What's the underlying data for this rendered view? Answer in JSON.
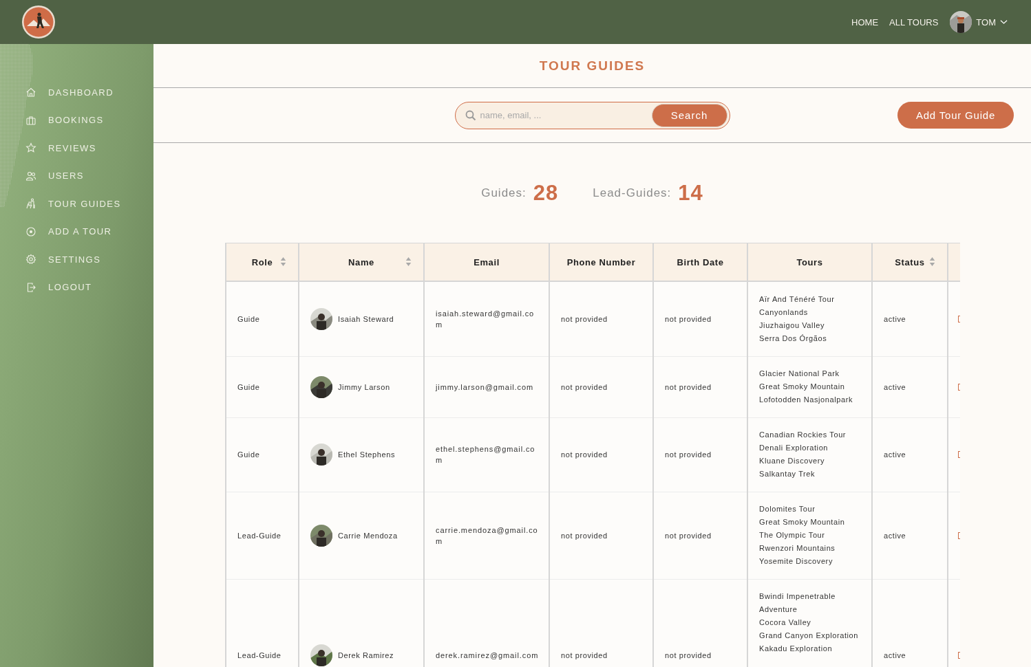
{
  "header": {
    "nav": [
      "HOME",
      "ALL TOURS"
    ],
    "user": {
      "name": "TOM"
    }
  },
  "sidebar": {
    "items": [
      {
        "label": "DASHBOARD"
      },
      {
        "label": "BOOKINGS"
      },
      {
        "label": "REVIEWS"
      },
      {
        "label": "USERS"
      },
      {
        "label": "TOUR GUIDES"
      },
      {
        "label": "ADD A TOUR"
      },
      {
        "label": "SETTINGS"
      },
      {
        "label": "LOGOUT"
      }
    ]
  },
  "page": {
    "title": "TOUR GUIDES"
  },
  "search": {
    "placeholder": "name, email, ...",
    "button": "Search"
  },
  "add_button": "Add Tour Guide",
  "stats": [
    {
      "label": "Guides:",
      "value": "28"
    },
    {
      "label": "Lead-Guides:",
      "value": "14"
    }
  ],
  "table": {
    "columns": [
      {
        "label": "Role",
        "sortable": true
      },
      {
        "label": "Name",
        "sortable": true
      },
      {
        "label": "Email",
        "sortable": false
      },
      {
        "label": "Phone Number",
        "sortable": false
      },
      {
        "label": "Birth Date",
        "sortable": false
      },
      {
        "label": "Tours",
        "sortable": false
      },
      {
        "label": "Status",
        "sortable": true
      }
    ],
    "rows": [
      {
        "role": "Guide",
        "name": "Isaiah Steward",
        "email": "isaiah.steward@gmail.com",
        "phone": "not provided",
        "birth_date": "not provided",
        "tours": [
          "Aïr And Ténéré Tour",
          "Canyonlands",
          "Jiuzhaigou Valley",
          "Serra Dos Órgãos"
        ],
        "status": "active"
      },
      {
        "role": "Guide",
        "name": "Jimmy Larson",
        "email": "jimmy.larson@gmail.com",
        "phone": "not provided",
        "birth_date": "not provided",
        "tours": [
          "Glacier National Park",
          "Great Smoky Mountain",
          "Lofotodden Nasjonalpark"
        ],
        "status": "active"
      },
      {
        "role": "Guide",
        "name": "Ethel Stephens",
        "email": "ethel.stephens@gmail.com",
        "phone": "not provided",
        "birth_date": "not provided",
        "tours": [
          "Canadian Rockies Tour",
          "Denali Exploration",
          "Kluane Discovery",
          "Salkantay Trek"
        ],
        "status": "active"
      },
      {
        "role": "Lead-Guide",
        "name": "Carrie Mendoza",
        "email": "carrie.mendoza@gmail.com",
        "phone": "not provided",
        "birth_date": "not provided",
        "tours": [
          "Dolomites Tour",
          "Great Smoky Mountain",
          "The Olympic Tour",
          "Rwenzori Mountains",
          "Yosemite Discovery"
        ],
        "status": "active"
      },
      {
        "role": "Lead-Guide",
        "name": "Derek Ramirez",
        "email": "derek.ramirez@gmail.com",
        "phone": "not provided",
        "birth_date": "not provided",
        "tours": [
          "Bwindi Impenetrable Adventure",
          "Cocora Valley",
          "Grand Canyon Exploration",
          "Kakadu Exploration"
        ],
        "status": "active"
      }
    ]
  }
}
